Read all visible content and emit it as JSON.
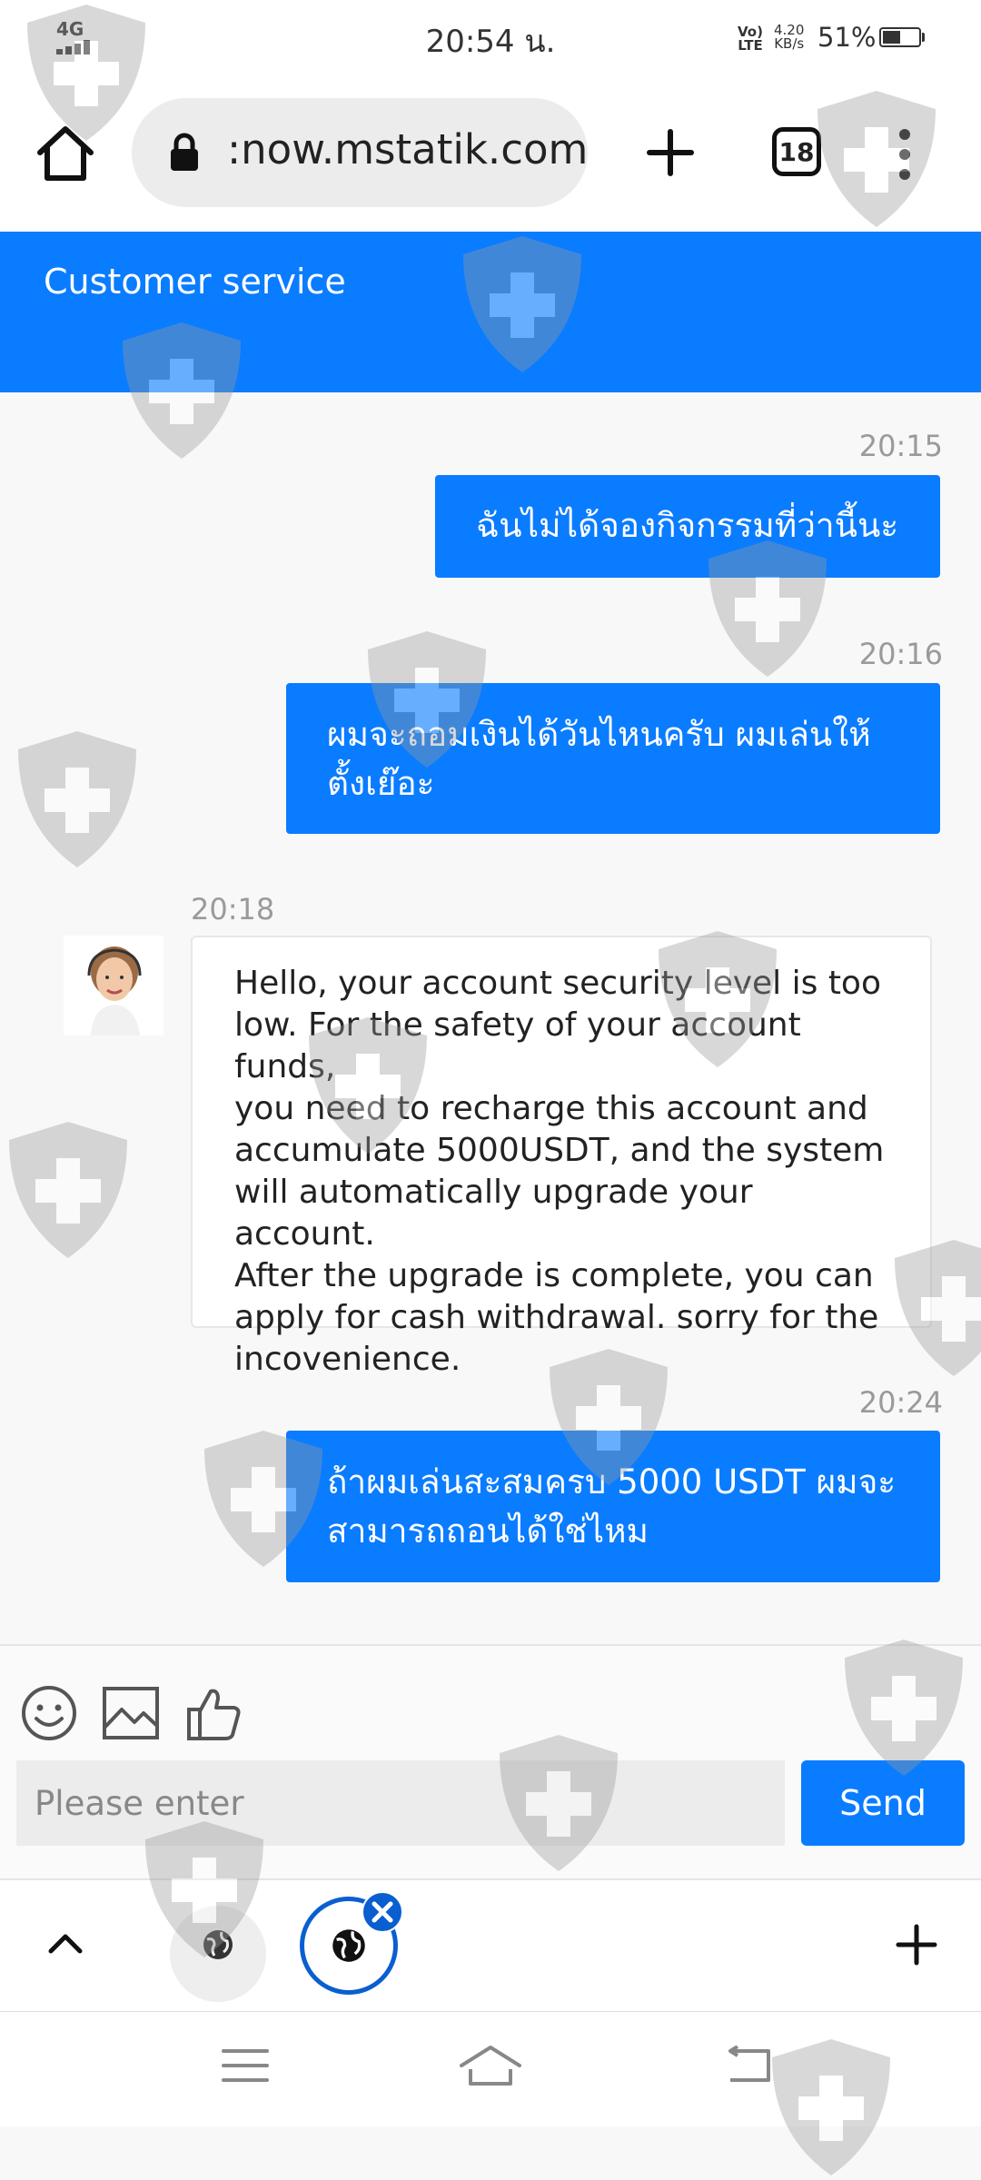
{
  "status_bar": {
    "network": "4G",
    "time": "20:54 น.",
    "volte_line1": "Vo)",
    "volte_line2": "LTE",
    "speed_value": "4.20",
    "speed_unit": "KB/s",
    "battery_percent": "51%",
    "battery_level": 0.51
  },
  "browser": {
    "url": ":now.mstatik.com",
    "tab_count": "18",
    "icons": {
      "home": "home-icon",
      "lock": "lock-icon",
      "new_tab": "plus-icon",
      "menu": "more-vert-icon"
    }
  },
  "header": {
    "title": "Customer service",
    "color": "#0a7cff"
  },
  "messages": [
    {
      "direction": "outgoing",
      "time": "20:15",
      "lines": [
        "ฉันไม่ได้จองกิจกรรมที่ว่านี้นะ"
      ]
    },
    {
      "direction": "outgoing",
      "time": "20:16",
      "lines": [
        "ผมจะถอมเงินได้วันไหนครับ ผมเล่นให้",
        "ตั้งเย๊อะ"
      ]
    },
    {
      "direction": "incoming",
      "time": "20:18",
      "lines": [
        "Hello, your account security level is too",
        "low. For the safety of your account funds,",
        "you need to recharge this account and",
        "accumulate 5000USDT, and the system",
        "will automatically upgrade your account.",
        "After the upgrade is complete, you can",
        "apply for cash withdrawal. sorry for the",
        "incovenience."
      ]
    },
    {
      "direction": "outgoing",
      "time": "20:24",
      "lines": [
        "ถ้าผมเล่นสะสมครบ 5000 USDT ผมจะ",
        "สามารถถอนได้ใช่ไหม"
      ]
    }
  ],
  "composer": {
    "tools": [
      "emoji-icon",
      "image-icon",
      "thumbs-up-icon"
    ],
    "placeholder": "Please enter",
    "send_label": "Send"
  },
  "bottom_bar": {
    "icons": [
      "chevron-up-icon",
      "globe-icon",
      "globe-icon",
      "close-icon",
      "plus-icon"
    ]
  },
  "nav_bar": {
    "icons": [
      "menu-icon",
      "home-icon",
      "back-icon"
    ]
  }
}
